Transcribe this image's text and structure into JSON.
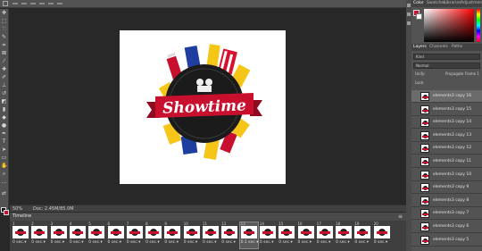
{
  "statusbar": {
    "zoom": "50%",
    "doc": "Doc: 2.45M/85.0M"
  },
  "panels": {
    "color_tabs": [
      "Color",
      "Swatches",
      "Libraries",
      "Adjustments"
    ],
    "layer_tabs": [
      "Layers",
      "Channels",
      "Paths"
    ],
    "kind_label": "Kind",
    "blend_label": "Normal",
    "unify_label": "Unify:",
    "propagate_label": "Propagate Frame 1",
    "lock_label": "Lock:"
  },
  "artwork": {
    "title": "Showtime"
  },
  "timeline": {
    "title": "Timeline",
    "frames": [
      {
        "n": "1",
        "delay": "0 sec.▾"
      },
      {
        "n": "2",
        "delay": "0 sec.▾"
      },
      {
        "n": "3",
        "delay": "0 sec.▾"
      },
      {
        "n": "4",
        "delay": "0 sec.▾"
      },
      {
        "n": "5",
        "delay": "0 sec.▾"
      },
      {
        "n": "6",
        "delay": "0 sec.▾"
      },
      {
        "n": "7",
        "delay": "0 sec.▾"
      },
      {
        "n": "8",
        "delay": "0 sec.▾"
      },
      {
        "n": "9",
        "delay": "0 sec.▾"
      },
      {
        "n": "10",
        "delay": "0 sec.▾"
      },
      {
        "n": "11",
        "delay": "0 sec.▾"
      },
      {
        "n": "12",
        "delay": "0 sec.▾"
      },
      {
        "n": "13",
        "delay": "0.1 sec.▾"
      },
      {
        "n": "14",
        "delay": "0 sec.▾"
      },
      {
        "n": "15",
        "delay": "0 sec.▾"
      },
      {
        "n": "16",
        "delay": "0 sec.▾"
      },
      {
        "n": "17",
        "delay": "0 sec.▾"
      },
      {
        "n": "18",
        "delay": "0 sec.▾"
      },
      {
        "n": "19",
        "delay": "0 sec.▾"
      },
      {
        "n": "20",
        "delay": "0 sec.▾"
      }
    ],
    "selected_index": 12
  },
  "layers": [
    {
      "name": "elements3 copy 16",
      "selected": true
    },
    {
      "name": "elements3 copy 15",
      "selected": false
    },
    {
      "name": "elements3 copy 14",
      "selected": false
    },
    {
      "name": "elements3 copy 13",
      "selected": false
    },
    {
      "name": "elements3 copy 12",
      "selected": false
    },
    {
      "name": "elements3 copy 11",
      "selected": false
    },
    {
      "name": "elements3 copy 10",
      "selected": false
    },
    {
      "name": "elements3 copy 9",
      "selected": false
    },
    {
      "name": "elements3 copy 8",
      "selected": false
    },
    {
      "name": "elements3 copy 7",
      "selected": false
    },
    {
      "name": "elements3 copy 6",
      "selected": false
    },
    {
      "name": "elements3 copy 5",
      "selected": false
    }
  ],
  "colors": {
    "accent_red": "#c8102e",
    "workspace": "#282828",
    "panel": "#535353"
  }
}
